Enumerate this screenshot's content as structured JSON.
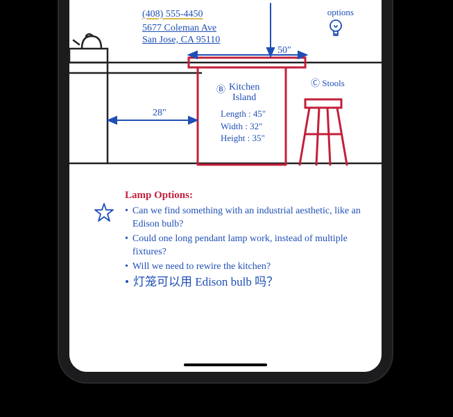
{
  "contact": {
    "phone": "(408) 555-4450",
    "address_line1": "5677 Coleman Ave",
    "address_line2": "San Jose, CA 95110"
  },
  "options_label": "options",
  "dimensions": {
    "top_width": "50\"",
    "gap": "28\""
  },
  "island": {
    "marker": "Ⓑ",
    "label_line1": "Kitchen",
    "label_line2": "Island",
    "length": "Length : 45\"",
    "width": "Width : 32\"",
    "height": "Height : 35\""
  },
  "stools": {
    "marker": "Ⓒ",
    "label": "Stools"
  },
  "lamp": {
    "heading": "Lamp Options:",
    "bullets": [
      "Can we find something with an industrial aesthetic, like an Edison bulb?",
      "Could one long pendant lamp work, instead of multiple fixtures?",
      "Will we need to rewire the kitchen?",
      "灯笼可以用 Edison bulb 吗？"
    ]
  }
}
